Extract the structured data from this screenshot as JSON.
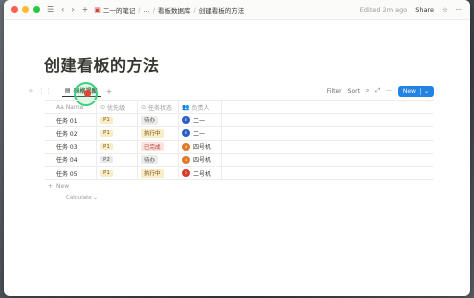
{
  "topbar": {
    "back_icon": "chevron-left",
    "forward_icon": "chevron-right",
    "breadcrumbs": [
      "二一的笔记",
      "...",
      "看板数据库",
      "创建看板的方法"
    ],
    "edited": "Edited 2m ago",
    "share": "Share"
  },
  "page": {
    "title": "创建看板的方法"
  },
  "view": {
    "tab_label": "表格视图",
    "filter": "Filter",
    "sort": "Sort",
    "new": "New"
  },
  "table": {
    "headers": [
      "Aa Name",
      "优先级",
      "任务状态",
      "负责人"
    ],
    "rows": [
      {
        "name": "任务 01",
        "priority": "P1",
        "status": "待办",
        "owner": "二一",
        "avatar_color": "#2a5fc4",
        "avatar_text": "E"
      },
      {
        "name": "任务 02",
        "priority": "P1",
        "status": "执行中",
        "owner": "二一",
        "avatar_color": "#2a5fc4",
        "avatar_text": "E"
      },
      {
        "name": "任务 03",
        "priority": "P1",
        "status": "已完成",
        "owner": "四号机",
        "avatar_color": "#e07a2a",
        "avatar_text": "4"
      },
      {
        "name": "任务 04",
        "priority": "P2",
        "status": "待办",
        "owner": "四号机",
        "avatar_color": "#e07a2a",
        "avatar_text": "4"
      },
      {
        "name": "任务 05",
        "priority": "P1",
        "status": "执行中",
        "owner": "二号机",
        "avatar_color": "#d63a2a",
        "avatar_text": "2"
      }
    ],
    "new_label": "New",
    "calculate": "Calculate"
  },
  "colors": {
    "accent": "#2383e2"
  }
}
